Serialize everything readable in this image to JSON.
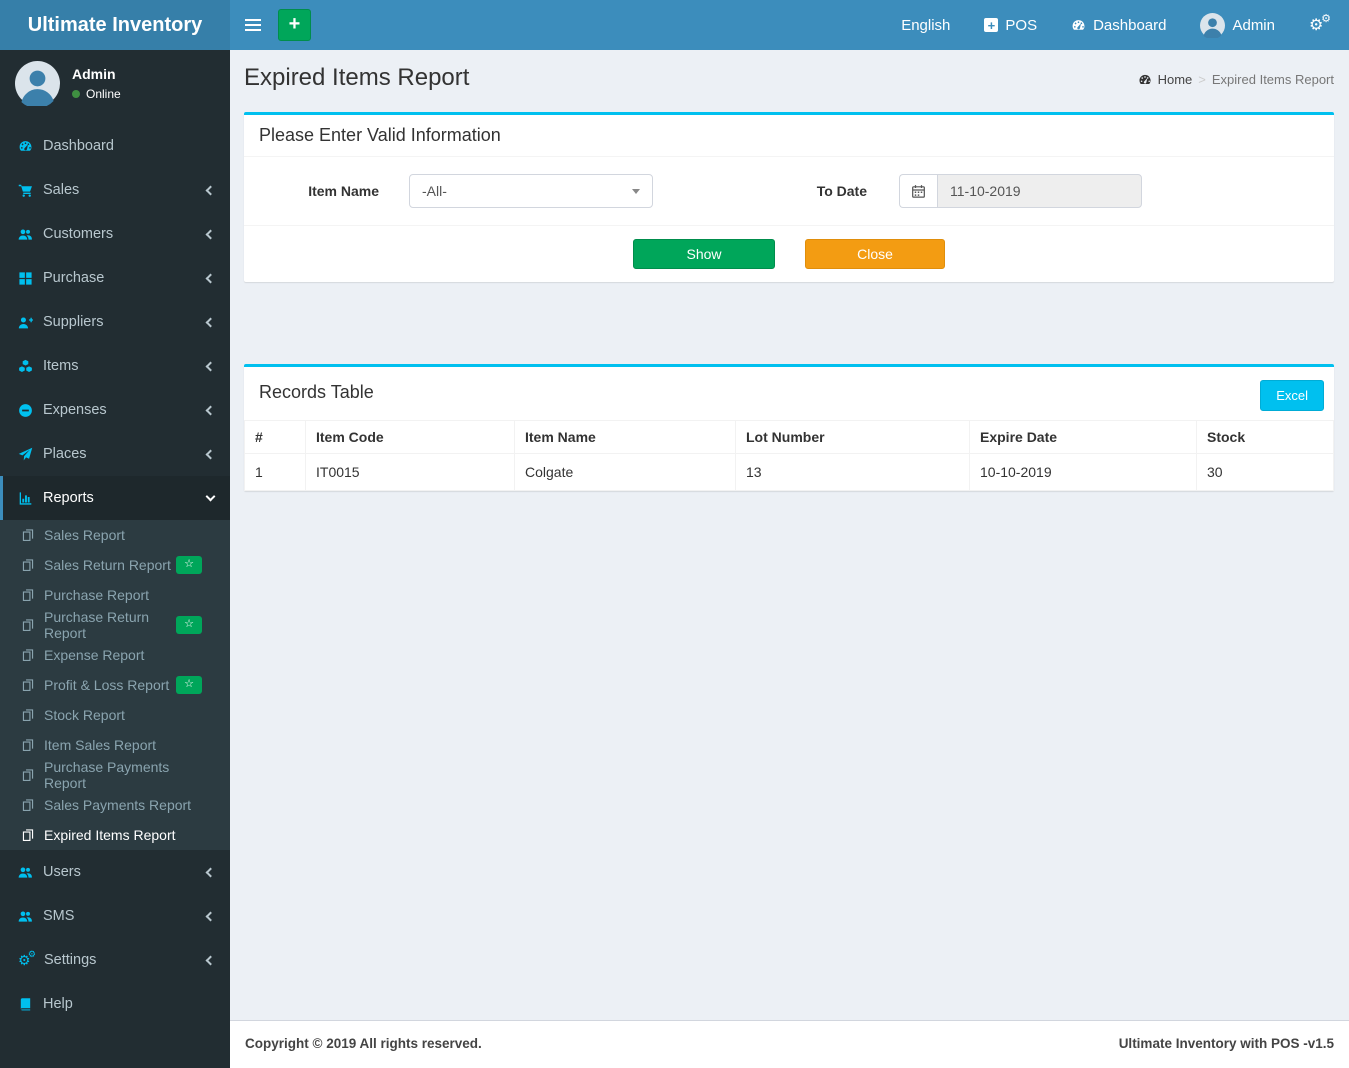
{
  "colors": {
    "navbar": "#3c8dbc",
    "logo_bg": "#367fa9",
    "sidebar_bg": "#222d32",
    "submenu_bg": "#2c3b41",
    "accent_cyan": "#00c0ef",
    "green": "#00a65a",
    "orange": "#f39c12"
  },
  "header": {
    "brand": "Ultimate Inventory",
    "nav": {
      "language": "English",
      "pos": "POS",
      "dashboard": "Dashboard",
      "user": "Admin"
    }
  },
  "user_panel": {
    "name": "Admin",
    "status": "Online"
  },
  "menu": {
    "items": [
      {
        "label": "Dashboard",
        "icon": "tachometer-icon"
      },
      {
        "label": "Sales",
        "icon": "cart-icon"
      },
      {
        "label": "Customers",
        "icon": "users-icon"
      },
      {
        "label": "Purchase",
        "icon": "grid-icon"
      },
      {
        "label": "Suppliers",
        "icon": "user-plus-icon"
      },
      {
        "label": "Items",
        "icon": "cubes-icon"
      },
      {
        "label": "Expenses",
        "icon": "minus-circle-icon"
      },
      {
        "label": "Places",
        "icon": "paper-plane-icon"
      },
      {
        "label": "Reports",
        "icon": "bar-chart-icon"
      },
      {
        "label": "Users",
        "icon": "users-icon"
      },
      {
        "label": "SMS",
        "icon": "users-icon"
      },
      {
        "label": "Settings",
        "icon": "cogs-icon"
      },
      {
        "label": "Help",
        "icon": "book-icon"
      }
    ],
    "reports_submenu": [
      {
        "label": "Sales Report",
        "badge": ""
      },
      {
        "label": "Sales Return Report",
        "badge": "☆"
      },
      {
        "label": "Purchase Report",
        "badge": ""
      },
      {
        "label": "Purchase Return Report",
        "badge": "☆"
      },
      {
        "label": "Expense Report",
        "badge": ""
      },
      {
        "label": "Profit & Loss Report",
        "badge": "☆"
      },
      {
        "label": "Stock Report",
        "badge": ""
      },
      {
        "label": "Item Sales Report",
        "badge": ""
      },
      {
        "label": "Purchase Payments Report",
        "badge": ""
      },
      {
        "label": "Sales Payments Report",
        "badge": ""
      },
      {
        "label": "Expired Items Report",
        "badge": ""
      }
    ]
  },
  "page": {
    "title": "Expired Items Report",
    "breadcrumb": {
      "home": "Home",
      "current": "Expired Items Report"
    }
  },
  "filter": {
    "heading": "Please Enter Valid Information",
    "item_name_label": "Item Name",
    "item_name_value": "-All-",
    "to_date_label": "To Date",
    "to_date_value": "11-10-2019",
    "show_button": "Show",
    "close_button": "Close"
  },
  "records": {
    "heading": "Records Table",
    "excel_button": "Excel",
    "columns": [
      "#",
      "Item Code",
      "Item Name",
      "Lot Number",
      "Expire Date",
      "Stock"
    ],
    "rows": [
      [
        "1",
        "IT0015",
        "Colgate",
        "13",
        "10-10-2019",
        "30"
      ]
    ]
  },
  "footer": {
    "copyright": "Copyright © 2019 All rights reserved.",
    "version": "Ultimate Inventory with POS -v1.5"
  }
}
